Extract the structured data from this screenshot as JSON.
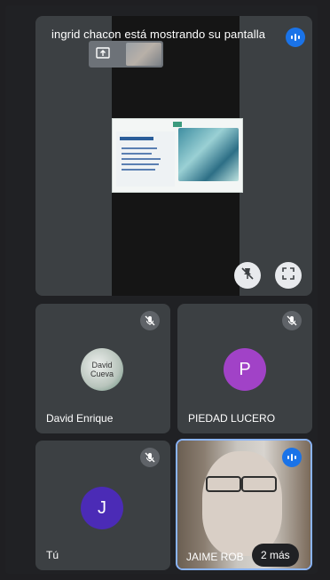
{
  "presentation": {
    "title": "ingrid chacon está mostrando su pantalla",
    "slide_heading": "Nuestros objetivos"
  },
  "participants": [
    {
      "name": "David Enrique",
      "avatar_text": "David Cueva",
      "avatar_kind": "image",
      "muted": true
    },
    {
      "name": "PIEDAD LUCERO",
      "avatar_text": "P",
      "avatar_kind": "letter",
      "muted": true,
      "color": "#a142c7"
    },
    {
      "name": "Tú",
      "avatar_text": "J",
      "avatar_kind": "letter",
      "muted": true,
      "color": "#4b2bb6"
    },
    {
      "name": "JAIME ROB",
      "avatar_kind": "video",
      "speaking": true
    }
  ],
  "more_label": "2 más",
  "colors": {
    "accent": "#1a73e8",
    "tile": "#3c4043",
    "background": "#202124"
  },
  "icons": {
    "present": "present-to-all-icon",
    "pin": "pin-off-icon",
    "expand": "fullscreen-icon",
    "mic_off": "mic-off-icon",
    "speaking": "audio-level-icon"
  }
}
